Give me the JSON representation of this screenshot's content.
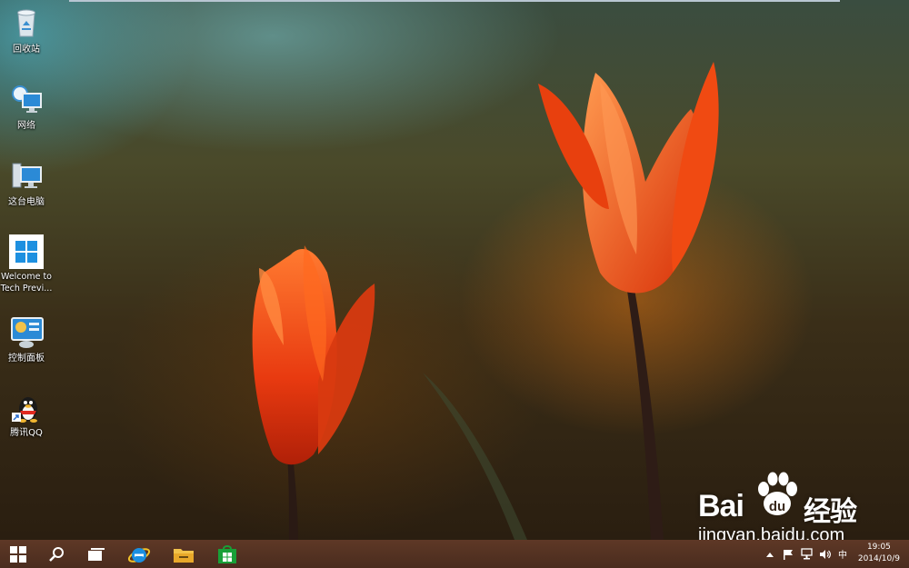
{
  "desktop_icons": [
    {
      "label": "回收站",
      "icon": "recycle-bin-icon"
    },
    {
      "label": "网络",
      "icon": "network-icon"
    },
    {
      "label": "这台电脑",
      "icon": "this-pc-icon"
    },
    {
      "label": "Welcome to Tech Previ...",
      "icon": "windows-welcome-icon"
    },
    {
      "label": "控制面板",
      "icon": "control-panel-icon"
    },
    {
      "label": "腾讯QQ",
      "icon": "qq-penguin-icon"
    }
  ],
  "watermark": {
    "brand_left": "Bai",
    "brand_right": "经验",
    "url": "jingyan.baidu.com"
  },
  "taskbar": {
    "buttons": [
      "start-icon",
      "search-icon",
      "task-view-icon",
      "internet-explorer-icon",
      "file-explorer-icon",
      "store-icon"
    ],
    "tray": {
      "input_method": "中",
      "time": "19:05",
      "date": "2014/10/9"
    }
  },
  "colors": {
    "taskbar": "#4a2c1e",
    "windows_blue": "#1e90e0",
    "accent_orange": "#e84a10"
  }
}
